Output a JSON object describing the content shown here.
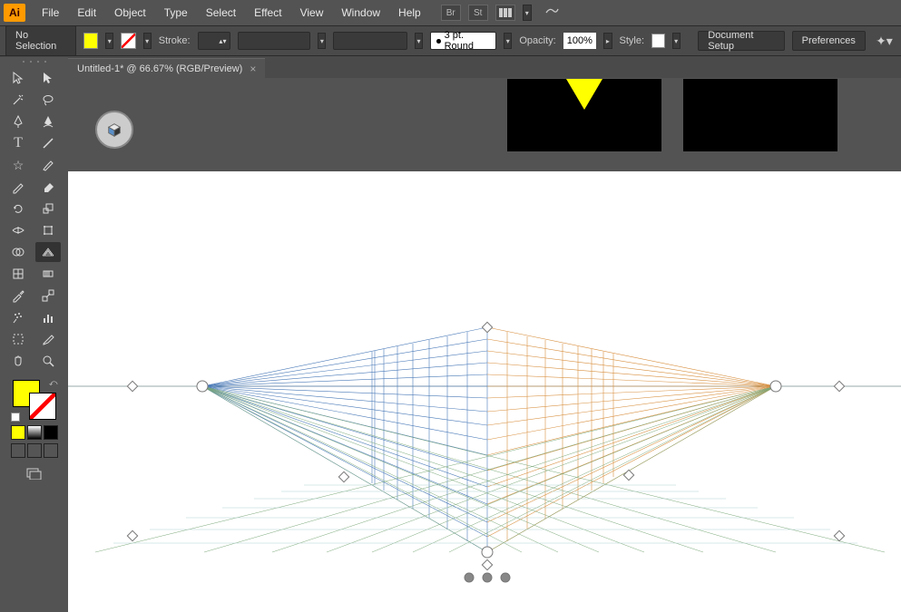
{
  "app": {
    "logo": "Ai"
  },
  "menu": {
    "items": [
      "File",
      "Edit",
      "Object",
      "Type",
      "Select",
      "Effect",
      "View",
      "Window",
      "Help"
    ],
    "ext": {
      "br": "Br",
      "st": "St"
    }
  },
  "control": {
    "selection": "No Selection",
    "stroke_label": "Stroke:",
    "profile_label": "3 pt. Round",
    "opacity_label": "Opacity:",
    "opacity_value": "100%",
    "style_label": "Style:",
    "doc_setup": "Document Setup",
    "preferences": "Preferences"
  },
  "tab": {
    "title": "Untitled-1* @ 66.67% (RGB/Preview)",
    "close": "×"
  },
  "colors": {
    "fill": "#ffff00",
    "stroke": "none",
    "row1": [
      "#ffff00",
      "#888888",
      "#000000"
    ],
    "row2_gradient": true
  }
}
